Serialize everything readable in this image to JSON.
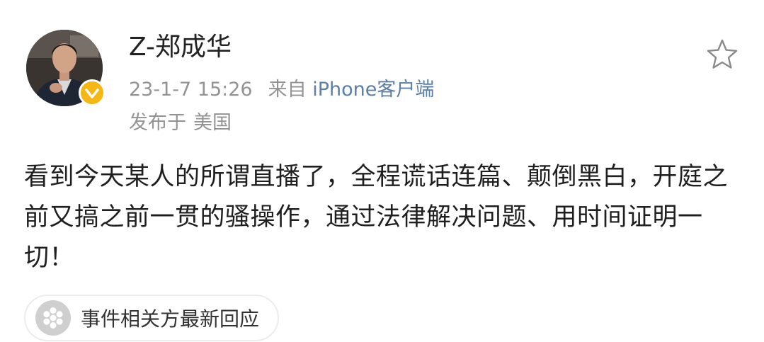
{
  "post": {
    "author": {
      "name": "Z-郑成华",
      "verified": true,
      "badge_color": "#f6b713"
    },
    "timestamp": "23-1-7 15:26",
    "source_prefix": "来自",
    "source_client": "iPhone客户端",
    "location_prefix": "发布于",
    "location": "美国",
    "favorite_icon": "star-outline-icon",
    "content": "看到今天某人的所谓直播了，全程谎话连篇、颠倒黑白，开庭之前又搞之前一贯的骚操作，通过法律解决问题、用时间证明一切！",
    "topic": {
      "icon": "flower-icon",
      "label": "事件相关方最新回应"
    }
  },
  "colors": {
    "meta_gray": "#939393",
    "link_blue": "#5b7ea8",
    "text": "#1f1f1f"
  }
}
